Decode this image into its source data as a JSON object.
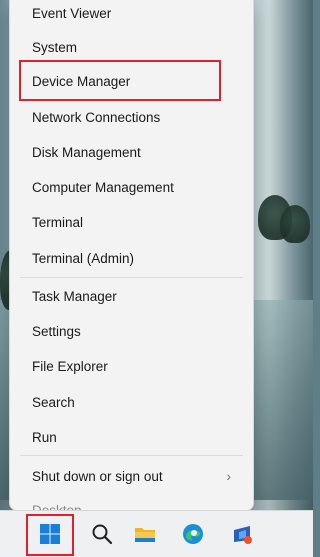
{
  "menu": {
    "items": [
      {
        "label": "Event Viewer"
      },
      {
        "label": "System"
      },
      {
        "label": "Device Manager"
      },
      {
        "label": "Network Connections"
      },
      {
        "label": "Disk Management"
      },
      {
        "label": "Computer Management"
      },
      {
        "label": "Terminal"
      },
      {
        "label": "Terminal (Admin)"
      },
      {
        "label": "Task Manager"
      },
      {
        "label": "Settings"
      },
      {
        "label": "File Explorer"
      },
      {
        "label": "Search"
      },
      {
        "label": "Run"
      },
      {
        "label": "Shut down or sign out"
      },
      {
        "label": "Desktop"
      }
    ],
    "submenu_chevron": "›"
  },
  "colors": {
    "highlight": "#e0202a",
    "menu_bg": "#f3f3f3",
    "taskbar_bg": "#eef0f2"
  },
  "taskbar": {
    "icons": [
      "windows-start-icon",
      "search-icon",
      "file-explorer-icon",
      "edge-browser-icon",
      "store-icon"
    ]
  }
}
